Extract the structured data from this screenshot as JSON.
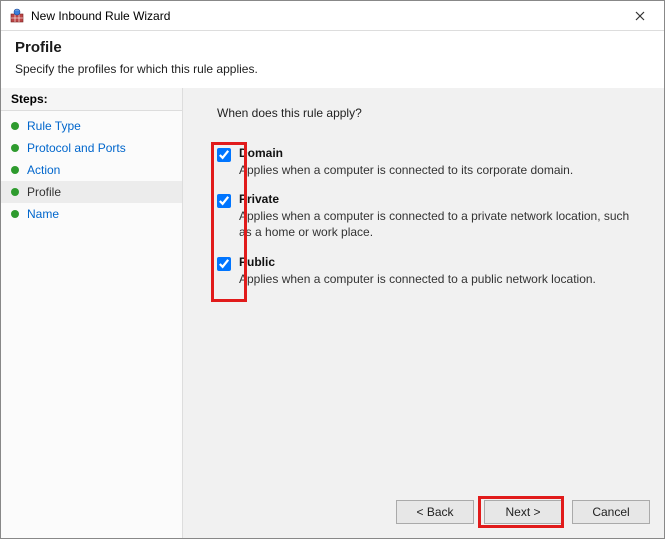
{
  "window": {
    "title": "New Inbound Rule Wizard"
  },
  "header": {
    "title": "Profile",
    "subtitle": "Specify the profiles for which this rule applies."
  },
  "steps": {
    "header": "Steps:",
    "items": [
      {
        "label": "Rule Type",
        "current": false
      },
      {
        "label": "Protocol and Ports",
        "current": false
      },
      {
        "label": "Action",
        "current": false
      },
      {
        "label": "Profile",
        "current": true
      },
      {
        "label": "Name",
        "current": false
      }
    ]
  },
  "content": {
    "question": "When does this rule apply?",
    "options": [
      {
        "label": "Domain",
        "desc": "Applies when a computer is connected to its corporate domain.",
        "checked": true
      },
      {
        "label": "Private",
        "desc": "Applies when a computer is connected to a private network location, such as a home or work place.",
        "checked": true
      },
      {
        "label": "Public",
        "desc": "Applies when a computer is connected to a public network location.",
        "checked": true
      }
    ]
  },
  "buttons": {
    "back": "< Back",
    "next": "Next >",
    "cancel": "Cancel"
  }
}
